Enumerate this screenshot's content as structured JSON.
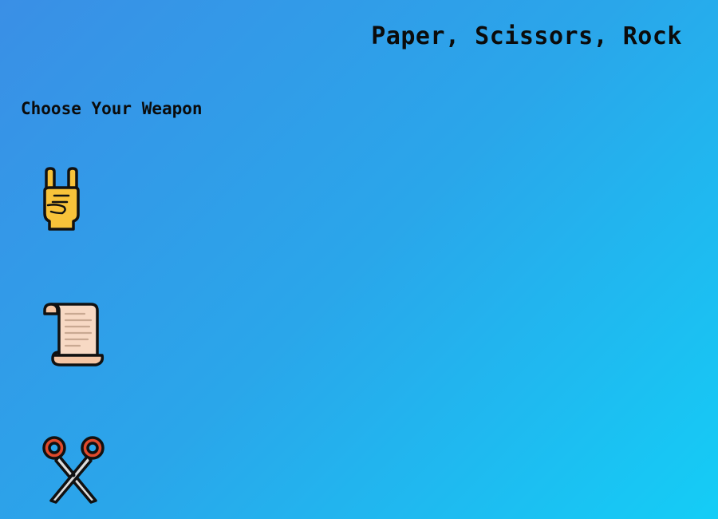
{
  "header": {
    "title": "Paper, Scissors, Rock"
  },
  "selection": {
    "heading": "Choose Your Weapon"
  },
  "weapons": [
    {
      "id": "rock",
      "icon": "rock-hand-icon"
    },
    {
      "id": "paper",
      "icon": "paper-scroll-icon"
    },
    {
      "id": "scissors",
      "icon": "scissors-icon"
    }
  ],
  "colors": {
    "background_start": "#3a8fe6",
    "background_end": "#14cdf6",
    "text": "#0b0b0b",
    "hand": "#f8c33a",
    "paper": "#f7d9c4",
    "scissors_handles": "#e04a2c"
  }
}
